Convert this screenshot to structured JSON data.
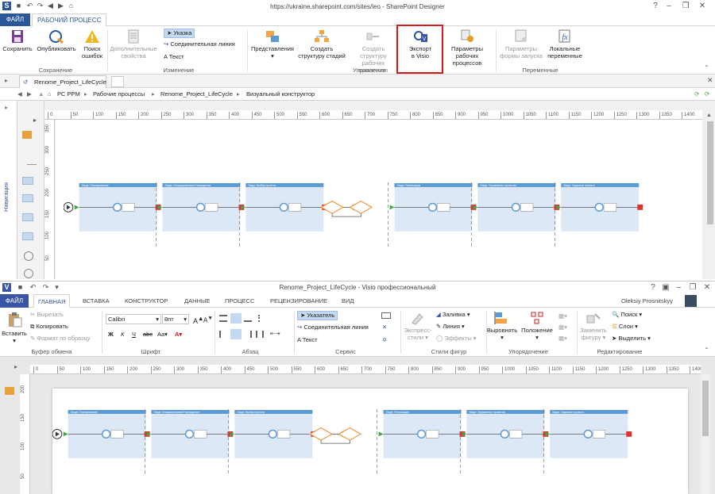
{
  "sp": {
    "url_title": "https://ukraine.sharepoint.com/sites/leo - SharePoint Designer",
    "tabs": {
      "file": "ФАЙЛ",
      "workflow": "РАБОЧИЙ ПРОЦЕСС"
    },
    "ribbon": {
      "save": "Сохранить",
      "publish": "Опубликовать",
      "check_line1": "Поиск",
      "check_line2": "ошибок",
      "extra_line1": "Дополнительные",
      "extra_line2": "свойства",
      "pointer": "Указка",
      "connector": "Соединительная линия",
      "text": "Текст",
      "views": "Представления",
      "create_stage_line1": "Создать",
      "create_stage_line2": "структуру стадий",
      "create_wf_line1": "Создать структуру",
      "create_wf_line2": "рабочих процессов",
      "export_line1": "Экспорт",
      "export_line2": "в Visio",
      "params_line1": "Параметры",
      "params_line2": "рабочих процессов",
      "form_params_line1": "Параметры",
      "form_params_line2": "формы запуска",
      "local_vars_line1": "Локальные",
      "local_vars_line2": "переменные",
      "groups": {
        "save": "Сохранение",
        "change": "Изменение",
        "manage": "Управление",
        "vars": "Переменные"
      }
    },
    "doc_tab": "Renome_Project_LifeCycle *",
    "breadcrumb": [
      "PC PPM",
      "Рабочие процессы",
      "Renome_Project_LifeCycle",
      "Визуальный конструктор"
    ],
    "nav_label": "Навигация",
    "ruler_h": [
      "0",
      "50",
      "100",
      "150",
      "200",
      "250",
      "300",
      "350",
      "400",
      "450",
      "500",
      "550",
      "600",
      "650",
      "700",
      "750",
      "800",
      "850",
      "900",
      "950",
      "1000",
      "1050",
      "1100",
      "1150",
      "1200",
      "1250",
      "1300",
      "1350",
      "1400"
    ],
    "ruler_v": [
      "350",
      "300",
      "250",
      "200",
      "150",
      "100",
      "50"
    ]
  },
  "visio": {
    "title": "Renome_Project_LifeCycle - Visio профессиональный",
    "tabs": [
      "ФАЙЛ",
      "ГЛАВНАЯ",
      "ВСТАВКА",
      "КОНСТРУКТОР",
      "ДАННЫЕ",
      "ПРОЦЕСС",
      "РЕЦЕНЗИРОВАНИЕ",
      "ВИД"
    ],
    "user": "Oleksiy Prosnitskyy",
    "ribbon": {
      "paste": "Вставить",
      "cut": "Вырезать",
      "copy": "Копировать",
      "format_painter": "Формат по образцу",
      "clipboard": "Буфер обмена",
      "font_name": "Calibri",
      "font_size": "8пт",
      "font_group": "Шрифт",
      "paragraph": "Абзац",
      "pointer": "Указатель",
      "connector": "Соединительная линия",
      "text": "Текст",
      "tools": "Сервис",
      "express_line1": "Экспресс-",
      "express_line2": "стили",
      "fill": "Заливка",
      "line": "Линия",
      "effects": "Эффекты",
      "shape_styles": "Стили фигур",
      "align": "Выровнять",
      "position": "Положение",
      "arrange": "Упорядочение",
      "change_line1": "Заменить",
      "change_line2": "фигуру",
      "find": "Поиск",
      "layers": "Слои",
      "select": "Выделить",
      "editing": "Редактирование"
    },
    "ruler_h": [
      "0",
      "50",
      "100",
      "150",
      "200",
      "250",
      "300",
      "350",
      "400",
      "450",
      "500",
      "550",
      "600",
      "650",
      "700",
      "750",
      "800",
      "850",
      "900",
      "950",
      "1000",
      "1050",
      "1100",
      "1150",
      "1200",
      "1250",
      "1300",
      "1350",
      "1400"
    ],
    "ruler_v": [
      "200",
      "150",
      "100",
      "50"
    ]
  },
  "stages": [
    "Stage: Планирование",
    "Stage: Инициирование/Утверждение",
    "Stage: Выбор проекта",
    "Stage: Реализация",
    "Stage: Управление проектом",
    "Stage: Закрытие проекта"
  ],
  "colors": {
    "accent": "#2b579a",
    "stage": "#dce8f5",
    "stage_header": "#5b9bd5",
    "end": "#e52e2e",
    "start_arrow": "#3fa83f",
    "cond": "#f08a24",
    "highlight": "#d01c1c"
  }
}
